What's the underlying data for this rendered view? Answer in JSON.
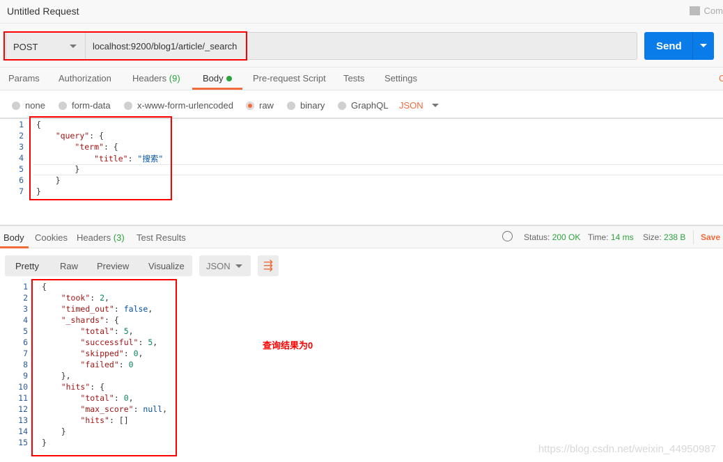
{
  "window": {
    "title": "Untitled Request",
    "comments_label": "Com"
  },
  "request": {
    "method": "POST",
    "url": "localhost:9200/blog1/article/_search",
    "send_label": "Send"
  },
  "request_tabs": [
    {
      "label": "Params"
    },
    {
      "label": "Authorization"
    },
    {
      "label": "Headers",
      "count": "(9)"
    },
    {
      "label": "Body",
      "active": true
    },
    {
      "label": "Pre-request Script"
    },
    {
      "label": "Tests"
    },
    {
      "label": "Settings"
    }
  ],
  "request_tabs_right": "C",
  "body_types": [
    {
      "label": "none"
    },
    {
      "label": "form-data"
    },
    {
      "label": "x-www-form-urlencoded"
    },
    {
      "label": "raw",
      "selected": true
    },
    {
      "label": "binary"
    },
    {
      "label": "GraphQL"
    }
  ],
  "body_format": "JSON",
  "request_body": [
    [
      [
        "p",
        "{"
      ]
    ],
    [
      [
        "p",
        "    "
      ],
      [
        "k",
        "\"query\""
      ],
      [
        "p",
        ": {"
      ]
    ],
    [
      [
        "p",
        "        "
      ],
      [
        "k",
        "\"term\""
      ],
      [
        "p",
        ": {"
      ]
    ],
    [
      [
        "p",
        "            "
      ],
      [
        "k",
        "\"title\""
      ],
      [
        "p",
        ": "
      ],
      [
        "s",
        "\"搜索\""
      ]
    ],
    [
      [
        "p",
        "        }"
      ]
    ],
    [
      [
        "p",
        "    }"
      ]
    ],
    [
      [
        "p",
        "}"
      ]
    ]
  ],
  "response_tabs": [
    {
      "label": "Body",
      "active": true
    },
    {
      "label": "Cookies"
    },
    {
      "label": "Headers",
      "count": "(3)"
    },
    {
      "label": "Test Results"
    }
  ],
  "response_status": {
    "status_label": "Status:",
    "status": "200 OK",
    "time_label": "Time:",
    "time": "14 ms",
    "size_label": "Size:",
    "size": "238 B",
    "save_label": "Save R"
  },
  "view_modes": [
    "Pretty",
    "Raw",
    "Preview",
    "Visualize"
  ],
  "response_format": "JSON",
  "response_body": [
    [
      [
        "p",
        "{"
      ]
    ],
    [
      [
        "p",
        "    "
      ],
      [
        "k",
        "\"took\""
      ],
      [
        "p",
        ": "
      ],
      [
        "n",
        "2"
      ],
      [
        "p",
        ","
      ]
    ],
    [
      [
        "p",
        "    "
      ],
      [
        "k",
        "\"timed_out\""
      ],
      [
        "p",
        ": "
      ],
      [
        "b",
        "false"
      ],
      [
        "p",
        ","
      ]
    ],
    [
      [
        "p",
        "    "
      ],
      [
        "k",
        "\"_shards\""
      ],
      [
        "p",
        ": {"
      ]
    ],
    [
      [
        "p",
        "        "
      ],
      [
        "k",
        "\"total\""
      ],
      [
        "p",
        ": "
      ],
      [
        "n",
        "5"
      ],
      [
        "p",
        ","
      ]
    ],
    [
      [
        "p",
        "        "
      ],
      [
        "k",
        "\"successful\""
      ],
      [
        "p",
        ": "
      ],
      [
        "n",
        "5"
      ],
      [
        "p",
        ","
      ]
    ],
    [
      [
        "p",
        "        "
      ],
      [
        "k",
        "\"skipped\""
      ],
      [
        "p",
        ": "
      ],
      [
        "n",
        "0"
      ],
      [
        "p",
        ","
      ]
    ],
    [
      [
        "p",
        "        "
      ],
      [
        "k",
        "\"failed\""
      ],
      [
        "p",
        ": "
      ],
      [
        "n",
        "0"
      ]
    ],
    [
      [
        "p",
        "    },"
      ]
    ],
    [
      [
        "p",
        "    "
      ],
      [
        "k",
        "\"hits\""
      ],
      [
        "p",
        ": {"
      ]
    ],
    [
      [
        "p",
        "        "
      ],
      [
        "k",
        "\"total\""
      ],
      [
        "p",
        ": "
      ],
      [
        "n",
        "0"
      ],
      [
        "p",
        ","
      ]
    ],
    [
      [
        "p",
        "        "
      ],
      [
        "k",
        "\"max_score\""
      ],
      [
        "p",
        ": "
      ],
      [
        "b",
        "null"
      ],
      [
        "p",
        ","
      ]
    ],
    [
      [
        "p",
        "        "
      ],
      [
        "k",
        "\"hits\""
      ],
      [
        "p",
        ": []"
      ]
    ],
    [
      [
        "p",
        "    }"
      ]
    ],
    [
      [
        "p",
        "}"
      ]
    ]
  ],
  "annotation": "查询结果为0",
  "watermark": "https://blog.csdn.net/weixin_44950987",
  "colors": {
    "accent": "#f26b3a",
    "send": "#0a7cea",
    "success": "#2ba23c",
    "highlight_box": "#ff0000"
  }
}
